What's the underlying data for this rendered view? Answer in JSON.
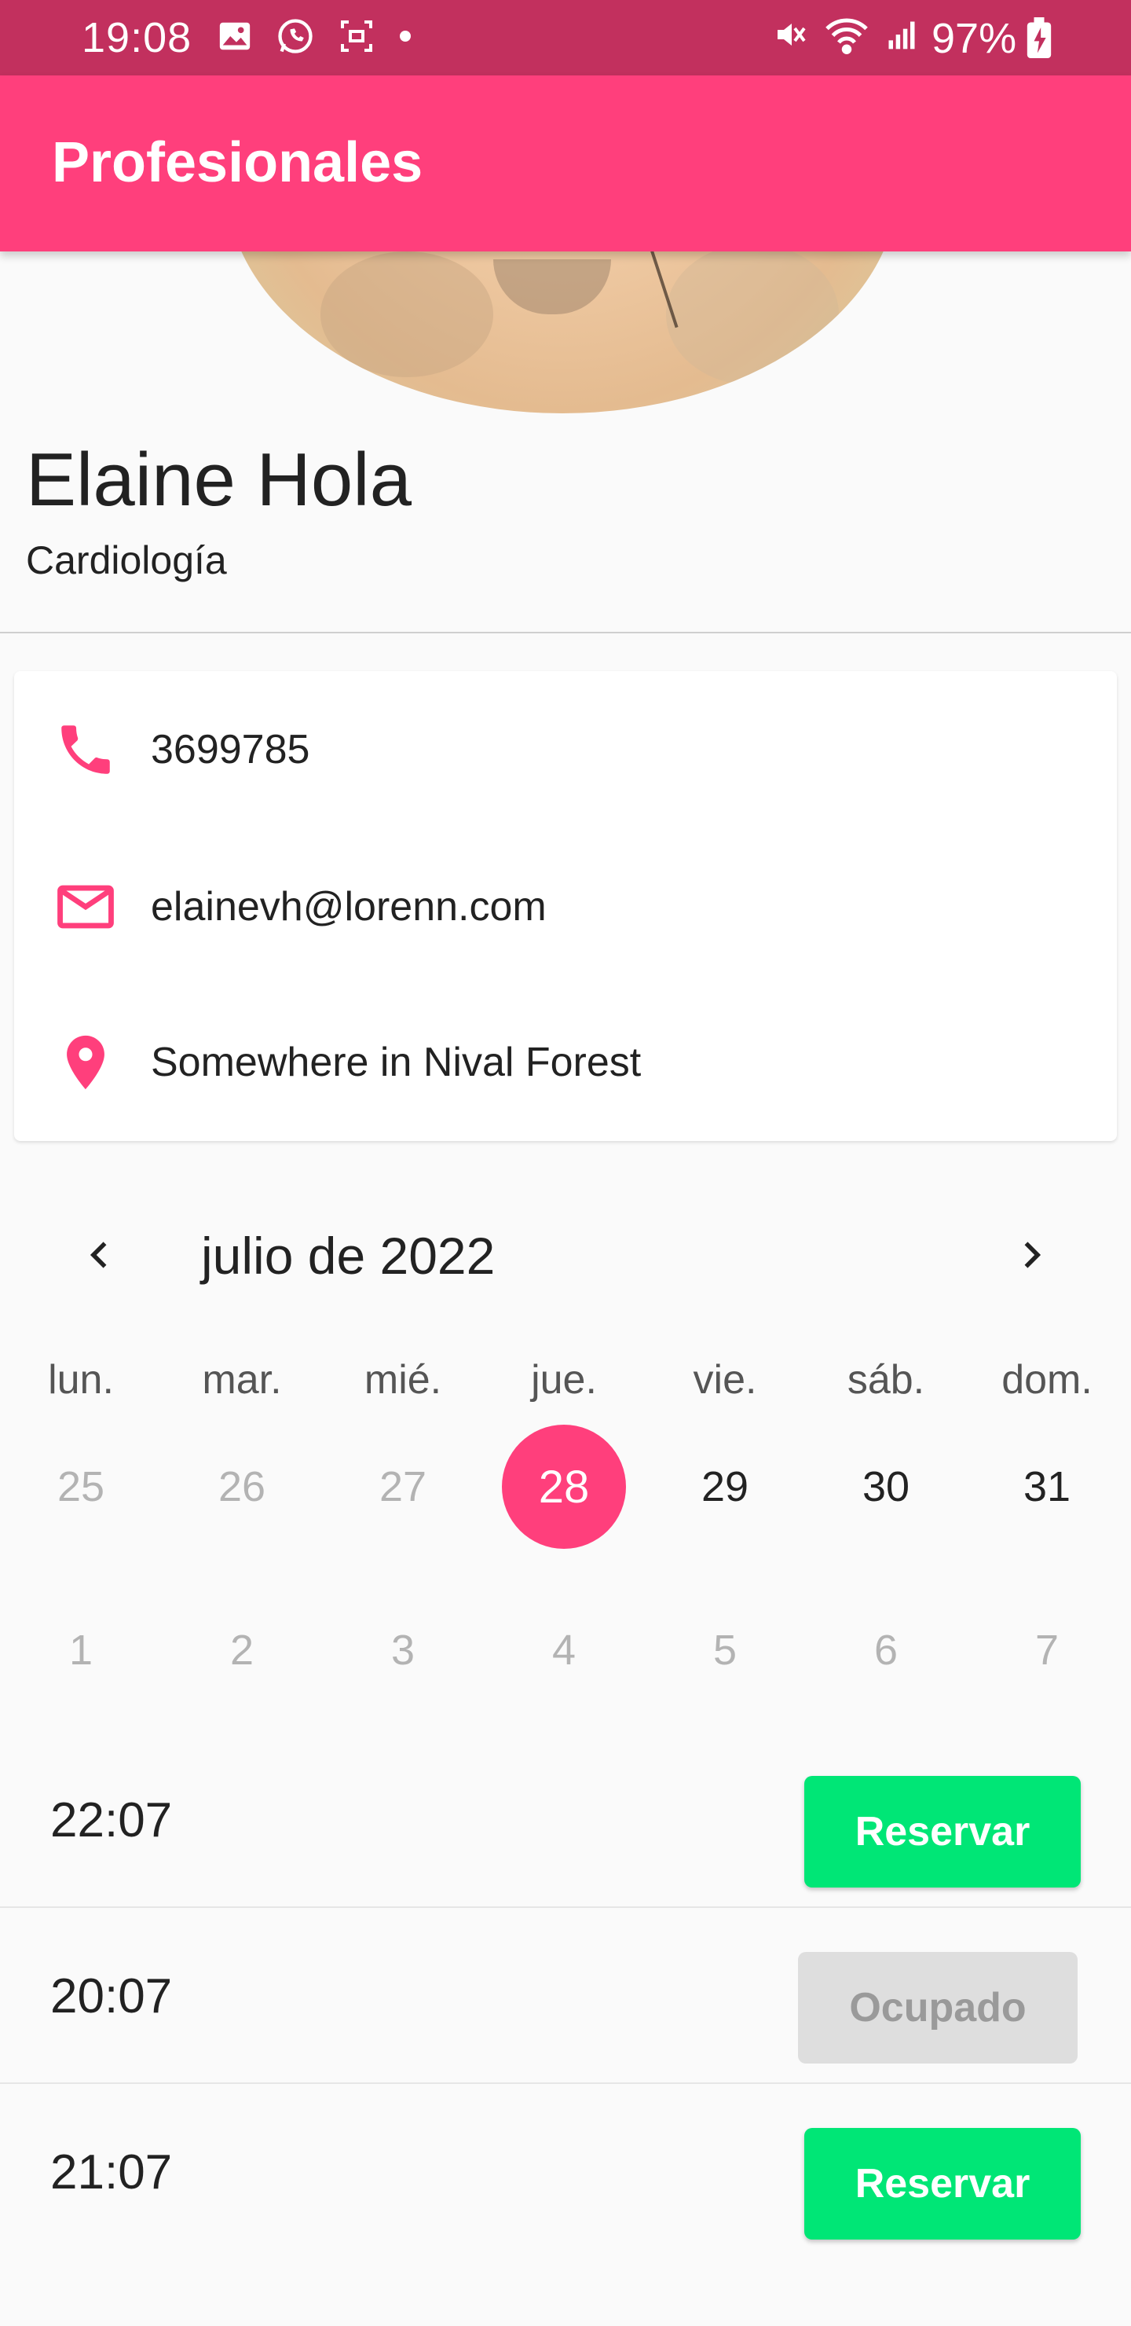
{
  "status_bar": {
    "time": "19:08",
    "battery_percent": "97%",
    "icons_left": [
      "image-icon",
      "whatsapp-icon",
      "screen-capture-icon",
      "dot-icon"
    ],
    "icons_right": [
      "mute-icon",
      "wifi-icon",
      "signal-icon",
      "battery-charging-icon"
    ]
  },
  "app_bar": {
    "title": "Profesionales"
  },
  "profile": {
    "name": "Elaine Hola",
    "specialty": "Cardiología"
  },
  "contact": [
    {
      "icon": "phone-icon",
      "text": "3699785"
    },
    {
      "icon": "mail-icon",
      "text": "elainevh@lorenn.com"
    },
    {
      "icon": "location-pin-icon",
      "text": "Somewhere in Nival Forest"
    }
  ],
  "calendar": {
    "month_label": "julio de 2022",
    "weekdays": [
      "lun.",
      "mar.",
      "mié.",
      "jue.",
      "vie.",
      "sáb.",
      "dom."
    ],
    "week1": [
      "25",
      "26",
      "27",
      "28",
      "29",
      "30",
      "31"
    ],
    "week2": [
      "1",
      "2",
      "3",
      "4",
      "5",
      "6",
      "7"
    ],
    "selected_day": "28"
  },
  "slots": [
    {
      "time": "22:07",
      "action": "Reservar",
      "state": "available"
    },
    {
      "time": "20:07",
      "action": "Ocupado",
      "state": "busy"
    },
    {
      "time": "21:07",
      "action": "Reservar",
      "state": "available"
    }
  ],
  "colors": {
    "status_bar": "#c2305e",
    "accent": "#ff3f7c",
    "book_button": "#00e676",
    "busy_button": "#dedede"
  }
}
